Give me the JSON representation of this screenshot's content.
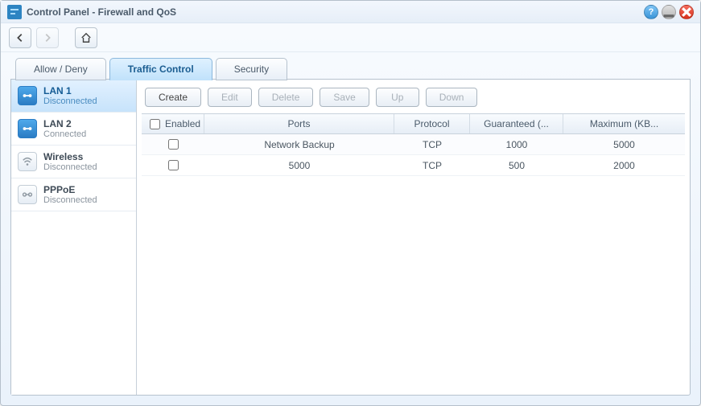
{
  "window": {
    "title": "Control Panel - Firewall and QoS"
  },
  "tabs": [
    {
      "label": "Allow / Deny",
      "active": false
    },
    {
      "label": "Traffic Control",
      "active": true
    },
    {
      "label": "Security",
      "active": false
    }
  ],
  "interfaces": [
    {
      "name": "LAN 1",
      "status": "Disconnected",
      "selected": true,
      "iconType": "lan-active"
    },
    {
      "name": "LAN 2",
      "status": "Connected",
      "selected": false,
      "iconType": "lan-active"
    },
    {
      "name": "Wireless",
      "status": "Disconnected",
      "selected": false,
      "iconType": "wireless"
    },
    {
      "name": "PPPoE",
      "status": "Disconnected",
      "selected": false,
      "iconType": "pppoe"
    }
  ],
  "buttons": {
    "create": "Create",
    "edit": "Edit",
    "delete": "Delete",
    "save": "Save",
    "up": "Up",
    "down": "Down"
  },
  "columns": {
    "enabled": "Enabled",
    "ports": "Ports",
    "protocol": "Protocol",
    "guaranteed": "Guaranteed (...",
    "maximum": "Maximum (KB..."
  },
  "rows": [
    {
      "enabled": false,
      "ports": "Network Backup",
      "protocol": "TCP",
      "guaranteed": "1000",
      "maximum": "5000"
    },
    {
      "enabled": false,
      "ports": "5000",
      "protocol": "TCP",
      "guaranteed": "500",
      "maximum": "2000"
    }
  ]
}
